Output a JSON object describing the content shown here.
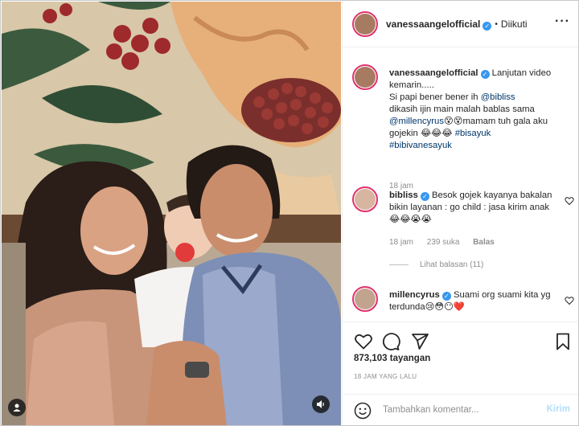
{
  "header": {
    "username": "vanessaangelofficial",
    "separator": "•",
    "follow_status": "Diikuti",
    "more_icon": "more-horizontal-icon"
  },
  "caption": {
    "username": "vanessaangelofficial",
    "text_1": "Lanjutan video kemarin.....",
    "text_2": "Si papi bener bener ih",
    "mention_1": "@bibliss",
    "text_3": "dikasih ijin main malah bablas sama",
    "mention_2": "@millencyrus",
    "text_4": "😵😵mamam tuh gala aku gojekin 😂😂😂",
    "hashtag_1": "#bisayuk",
    "hashtag_2": "#bibivanesayuk",
    "time": "18 jam"
  },
  "comments": [
    {
      "username": "bibliss",
      "text": "Besok gojek kayanya bakalan bikin layanan : go child : jasa kirim anak 😂😂😭😭",
      "time": "18 jam",
      "likes": "239 suka",
      "reply": "Balas",
      "view_replies": "Lihat balasan (11)"
    },
    {
      "username": "millencyrus",
      "text": "Suami org suami kita yg terdunda😢😳😶❤️"
    }
  ],
  "actions": {
    "like_icon": "heart-icon",
    "comment_icon": "comment-icon",
    "share_icon": "share-icon",
    "save_icon": "bookmark-icon"
  },
  "views": "873,103 tayangan",
  "posted_time": "18 JAM YANG LALU",
  "add_comment": {
    "placeholder": "Tambahkan komentar...",
    "post_label": "Kirim"
  },
  "colors": {
    "verified": "#3897f0",
    "link": "#00376b",
    "muted": "#8e8e8e",
    "story_ring": "#e1306c",
    "post_disabled": "#b2dffc"
  }
}
